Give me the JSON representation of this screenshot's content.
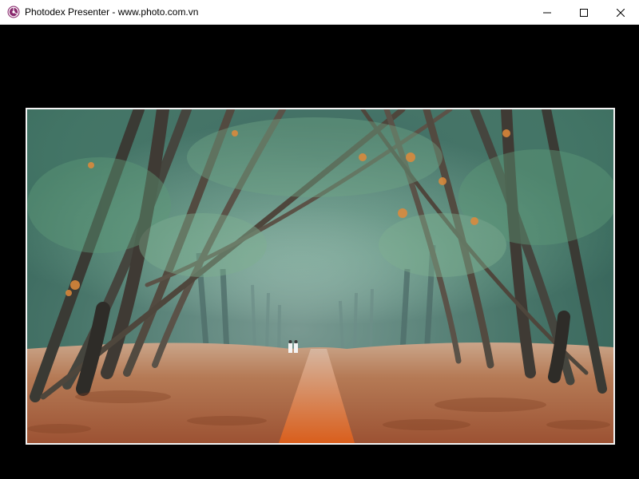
{
  "window": {
    "title": "Photodex Presenter - www.photo.com.vn",
    "app_icon": "photodex-logo-icon",
    "controls": [
      "minimize-icon",
      "maximize-icon",
      "close-icon"
    ]
  },
  "viewer": {
    "background": "#000000",
    "photo": {
      "subject": "misty tree-lined tunnel path covered with fallen orange leaves, two small figures in white in the distance",
      "frame_color": "#f2f2f2"
    }
  },
  "colors": {
    "mist": "#b8d0cc",
    "foliage": "#5f9a7a",
    "leaves_ground": "#b0633c",
    "path": "#d8601f",
    "accent_leaves": "#e08a3a"
  }
}
